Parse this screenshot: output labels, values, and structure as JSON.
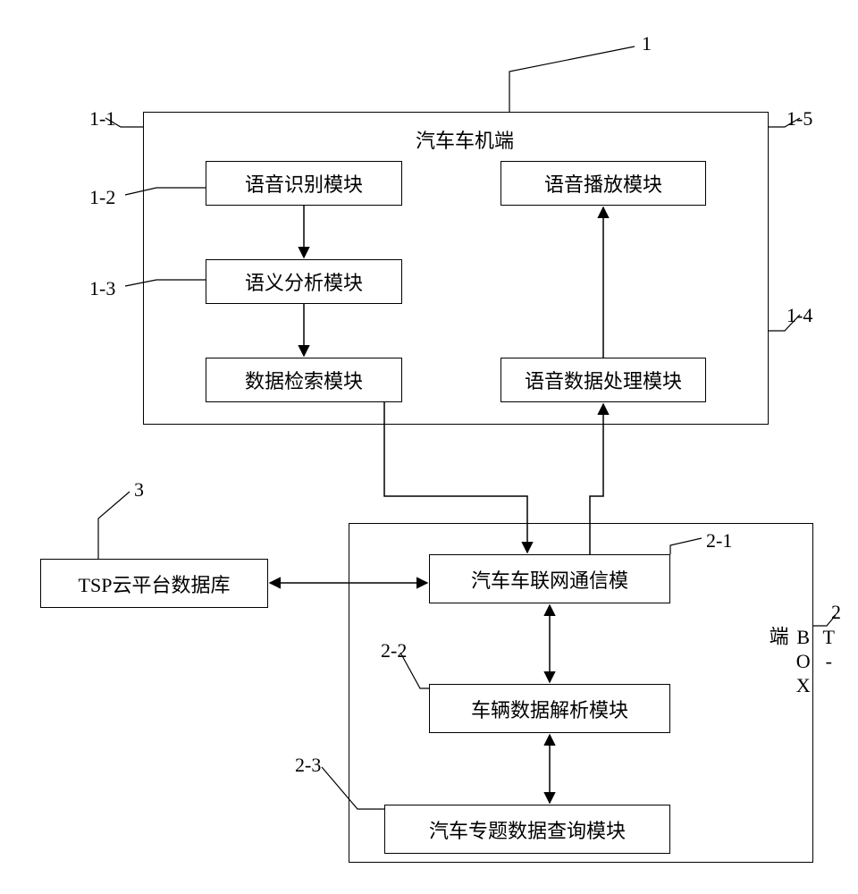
{
  "containers": {
    "top": {
      "label": "1",
      "title": "汽车车机端"
    },
    "bottom": {
      "label": "2",
      "title": "T-BOX端"
    }
  },
  "top_boxes": {
    "b11": {
      "label": "1-1",
      "text": "语音识别模块"
    },
    "b12": {
      "label": "1-2",
      "text": "语义分析模块"
    },
    "b13": {
      "label": "1-3",
      "text": "数据检索模块"
    },
    "b14": {
      "label": "1-4",
      "text": "语音数据处理模块"
    },
    "b15": {
      "label": "1-5",
      "text": "语音播放模块"
    }
  },
  "bottom_boxes": {
    "b21": {
      "label": "2-1",
      "text": "汽车车联网通信模"
    },
    "b22": {
      "label": "2-2",
      "text": "车辆数据解析模块"
    },
    "b23": {
      "label": "2-3",
      "text": "汽车专题数据查询模块"
    }
  },
  "external": {
    "tsp": {
      "label": "3",
      "text": "TSP云平台数据库"
    }
  }
}
